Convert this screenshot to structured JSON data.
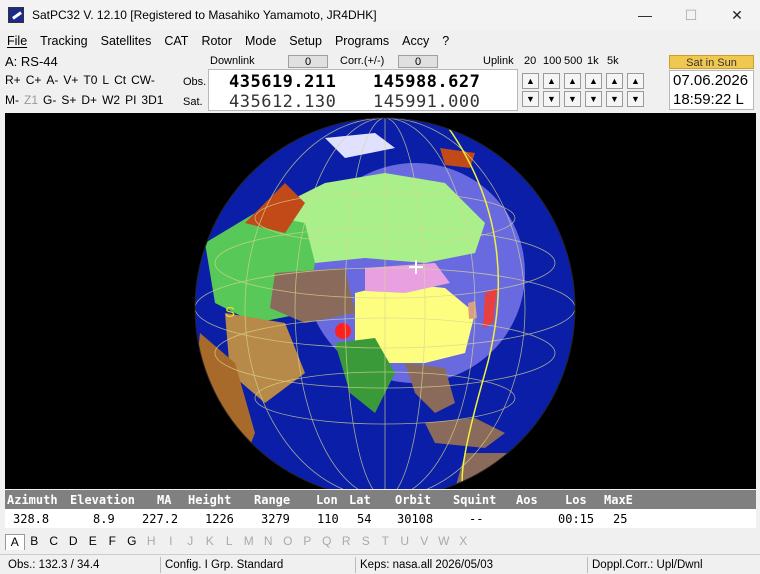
{
  "window": {
    "title": "SatPC32 V. 12.10   [Registered to Masahiko Yamamoto, JR4DHK]",
    "minimize": "—",
    "maximize": "☐",
    "close": "✕"
  },
  "menu": [
    {
      "label": "File"
    },
    {
      "label": "Tracking"
    },
    {
      "label": "Satellites"
    },
    {
      "label": "CAT"
    },
    {
      "label": "Rotor"
    },
    {
      "label": "Mode"
    },
    {
      "label": "Setup"
    },
    {
      "label": "Programs"
    },
    {
      "label": "Accy"
    },
    {
      "label": "?"
    }
  ],
  "toolbar": {
    "satellite": "A: RS-44",
    "row1": [
      "R+",
      "C+",
      "A-",
      "V+",
      "T0",
      "L",
      "Ct",
      "CW-"
    ],
    "row2": [
      "M-",
      "Z1",
      "G-",
      "S+",
      "D+",
      "W2",
      "PI",
      "3D1"
    ],
    "downlink_label": "Downlink",
    "downlink_value": "0",
    "corr_label": "Corr.(+/-)",
    "corr_value": "0",
    "uplink_label": "Uplink",
    "steps": [
      "20",
      "100",
      "500",
      "1k",
      "5k"
    ],
    "obs_label": "Obs.",
    "sat_label": "Sat.",
    "obs_down": "435619.211",
    "obs_up": "145988.627",
    "sat_down": "435612.130",
    "sat_up": "145991.000",
    "sun_status": "Sat in Sun",
    "date": "07.06.2026",
    "time": "18:59:22 L",
    "up_arrow": "▲",
    "down_arrow": "▼"
  },
  "map": {
    "sat_marker": "S",
    "colors": {
      "ocean": "#0a1ea8",
      "footprint": "#6a6ae0",
      "sky": "#000000"
    }
  },
  "table": {
    "headers": [
      "Azimuth",
      "Elevation",
      "MA",
      "Height",
      "Range",
      "Lon",
      "Lat",
      "Orbit",
      "Squint",
      "Aos",
      "Los",
      "MaxE"
    ],
    "values": [
      "328.8",
      "8.9",
      "227.2",
      "1226",
      "3279",
      "110",
      "54",
      "30108",
      "--",
      "",
      "00:15",
      "25"
    ]
  },
  "tabs": [
    "A",
    "B",
    "C",
    "D",
    "E",
    "F",
    "G",
    "H",
    "I",
    "J",
    "K",
    "L",
    "M",
    "N",
    "O",
    "P",
    "Q",
    "R",
    "S",
    "T",
    "U",
    "V",
    "W",
    "X"
  ],
  "status": {
    "obs": "Obs.: 132.3 / 34.4",
    "config": "Config. I  Grp. Standard",
    "keps": "Keps: nasa.all 2026/05/03",
    "doppler": "Doppl.Corr.: Upl/Dwnl"
  }
}
